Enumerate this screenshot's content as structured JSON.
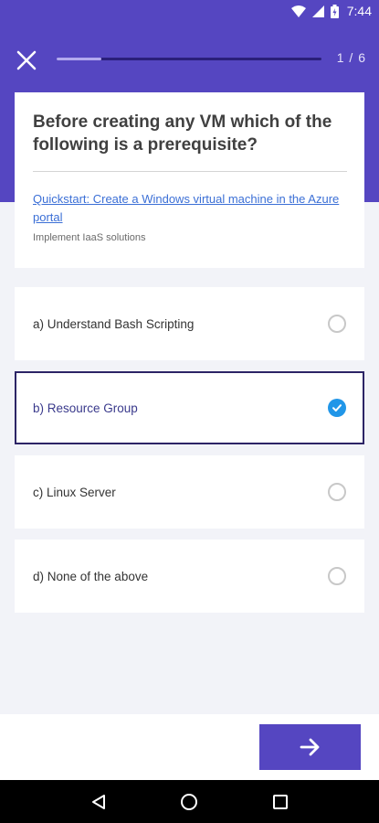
{
  "status_bar": {
    "time": "7:44"
  },
  "header": {
    "progress_label": "1 / 6",
    "progress_fraction": 0.17
  },
  "question": {
    "text": "Before creating any VM which of the following is a prerequisite?",
    "link_text": "Quickstart: Create a Windows virtual machine in the Azure portal",
    "topic": "Implement IaaS solutions"
  },
  "options": [
    {
      "label": "a) Understand Bash Scripting",
      "selected": false
    },
    {
      "label": "b) Resource Group",
      "selected": true
    },
    {
      "label": "c) Linux Server",
      "selected": false
    },
    {
      "label": "d) None of the above",
      "selected": false
    }
  ],
  "colors": {
    "primary": "#5546c1",
    "selected_border": "#2c2466",
    "check": "#2196e8",
    "link": "#3b6fd6"
  },
  "icons": {
    "close": "close-icon",
    "next": "arrow-right-icon",
    "checked": "check-circle-icon",
    "nav_back": "triangle-back-icon",
    "nav_home": "circle-home-icon",
    "nav_recents": "square-recents-icon"
  }
}
